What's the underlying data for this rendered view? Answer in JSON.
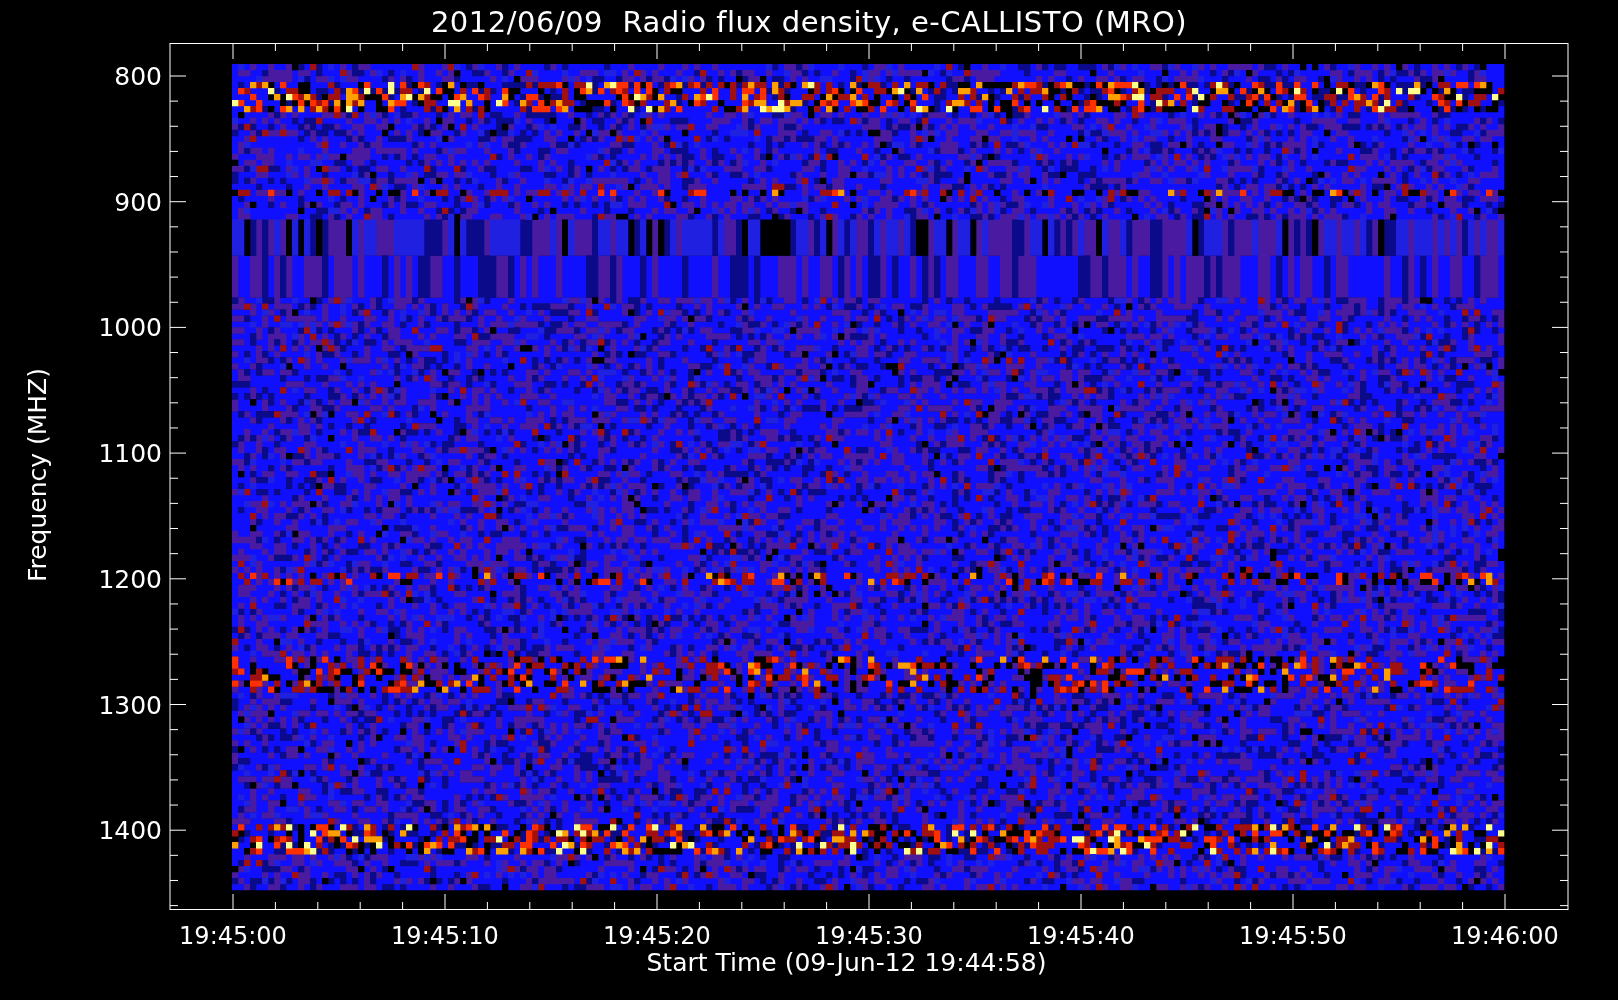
{
  "title": "2012/06/09  Radio flux density, e-CALLISTO (MRO)",
  "y_axis": {
    "label": "Frequency (MHZ)",
    "ticks": [
      "800",
      "900",
      "1000",
      "1100",
      "1200",
      "1300",
      "1400"
    ]
  },
  "x_axis": {
    "label": "Start Time (09-Jun-12 19:44:58)",
    "ticks": [
      "19:45:00",
      "19:45:10",
      "19:45:20",
      "19:45:30",
      "19:45:40",
      "19:45:50",
      "19:46:00"
    ]
  }
}
